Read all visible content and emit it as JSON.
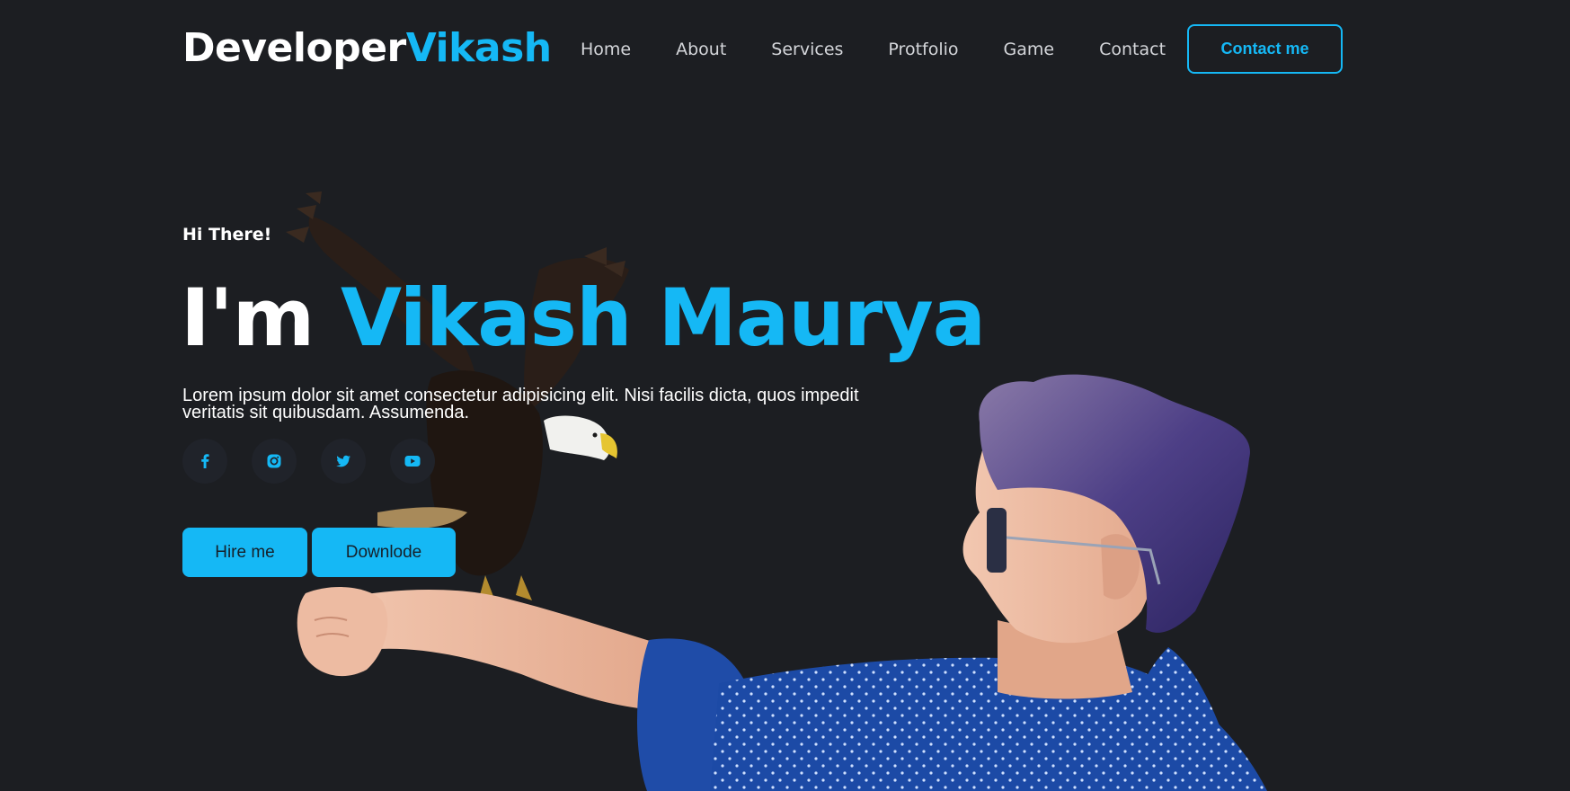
{
  "brand": {
    "first": "Developer",
    "second": "Vikash"
  },
  "nav": {
    "items": [
      {
        "label": "Home"
      },
      {
        "label": "About"
      },
      {
        "label": "Services"
      },
      {
        "label": "Protfolio"
      },
      {
        "label": "Game"
      },
      {
        "label": "Contact"
      }
    ],
    "cta_label": "Contact me"
  },
  "hero": {
    "greeting": "Hi There!",
    "headline_prefix": "I'm",
    "headline_name": "Vikash Maurya",
    "description": "Lorem ipsum dolor sit amet consectetur adipisicing elit. Nisi facilis dicta, quos impedit veritatis sit quibusdam. Assumenda.",
    "socials": [
      {
        "icon": "facebook-icon"
      },
      {
        "icon": "instagram-icon"
      },
      {
        "icon": "twitter-icon"
      },
      {
        "icon": "youtube-icon"
      }
    ],
    "hire_label": "Hire me",
    "download_label": "Downlode"
  },
  "colors": {
    "background": "#1c1e22",
    "accent": "#15b8f5",
    "text": "#ffffff",
    "nav_text": "#d4d6da"
  }
}
